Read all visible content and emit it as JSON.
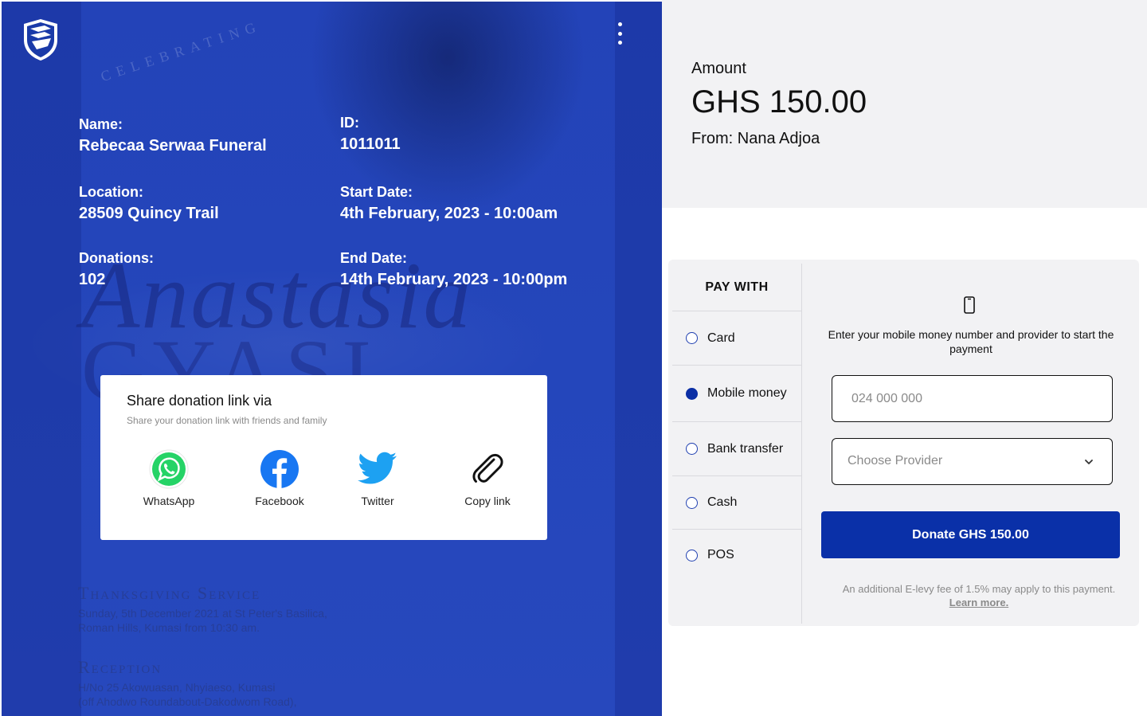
{
  "event": {
    "name_label": "Name:",
    "name_value": "Rebecaa Serwaa Funeral",
    "id_label": "ID:",
    "id_value": "1011011",
    "location_label": "Location:",
    "location_value": "28509 Quincy Trail",
    "start_label": "Start Date:",
    "start_value": "4th February, 2023 - 10:00am",
    "donations_label": "Donations:",
    "donations_value": "102",
    "end_label": "End Date:",
    "end_value": "14th February, 2023 - 10:00pm"
  },
  "background": {
    "script_text": "Anastasia",
    "caps_text": "GYASI",
    "celebrating": "CELEBRATING",
    "service_title": "Thanksgiving Service",
    "service_line1": "Sunday, 5th December 2021 at St Peter's Basilica,",
    "service_line2": "Roman Hills, Kumasi from 10:30 am.",
    "reception_title": "Reception",
    "reception_line1": "H/No 25 Akowuasan, Nhyiaeso, Kumasi",
    "reception_line2": "(off Ahodwo Roundabout-Dakodwom Road),"
  },
  "share": {
    "title": "Share donation link via",
    "subtitle": "Share your donation link with friends and family",
    "items": [
      {
        "label": "WhatsApp",
        "icon": "whatsapp-icon",
        "color": "#25D366"
      },
      {
        "label": "Facebook",
        "icon": "facebook-icon",
        "color": "#1877F2"
      },
      {
        "label": "Twitter",
        "icon": "twitter-icon",
        "color": "#1DA1F2"
      },
      {
        "label": "Copy link",
        "icon": "paperclip-icon",
        "color": "#111111"
      }
    ]
  },
  "amount": {
    "label": "Amount",
    "value": "GHS 150.00",
    "from": "From: Nana Adjoa"
  },
  "payment": {
    "header": "PAY WITH",
    "options": [
      {
        "label": "Card",
        "selected": false
      },
      {
        "label": "Mobile money",
        "selected": true
      },
      {
        "label": "Bank transfer",
        "selected": false
      },
      {
        "label": "Cash",
        "selected": false
      },
      {
        "label": "POS",
        "selected": false
      }
    ],
    "instruction": "Enter your mobile money number and provider to start the payment",
    "phone_placeholder": "024 000 000",
    "provider_placeholder": "Choose Provider",
    "donate_label": "Donate GHS 150.00",
    "levy_text": "An additional E-levy fee of 1.5% may apply to this payment.",
    "learn_more": "Learn more."
  },
  "colors": {
    "brand_blue": "#0a30a8",
    "panel_blue": "#1f3fb0",
    "panel_grey": "#f2f2f4"
  }
}
